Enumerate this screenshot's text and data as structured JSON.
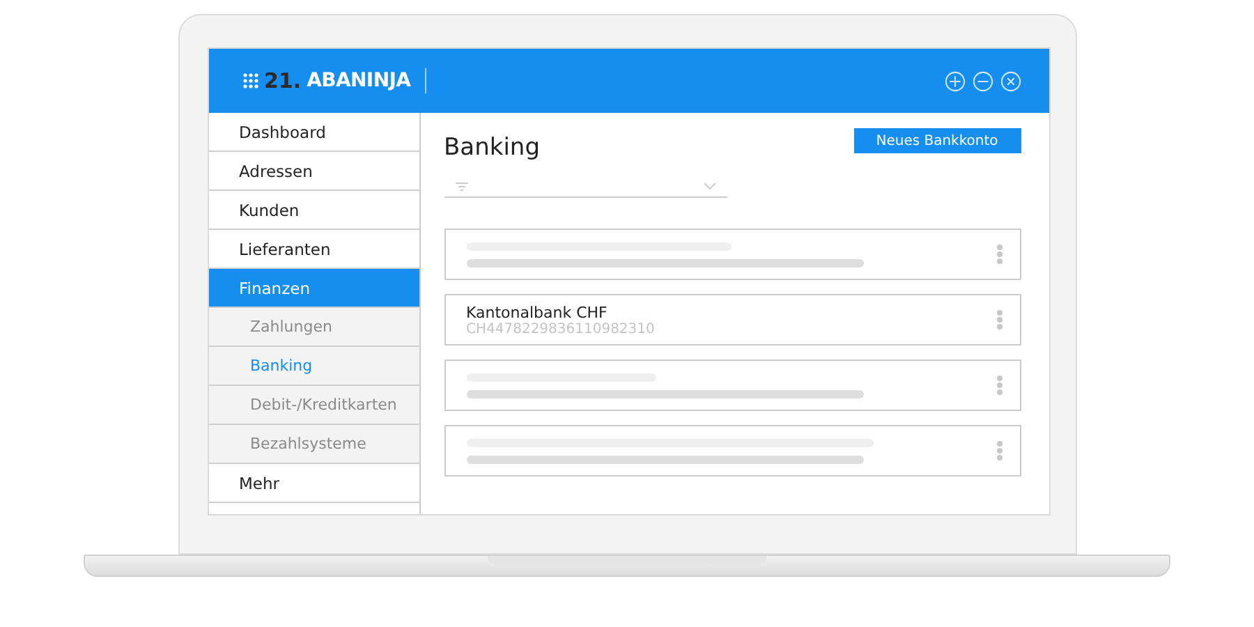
{
  "app": {
    "logo_number": "21.",
    "logo_name": "ABANINJA"
  },
  "sidebar": {
    "items": [
      {
        "label": "Dashboard",
        "kind": "main",
        "selected": false
      },
      {
        "label": "Adressen",
        "kind": "main",
        "selected": false
      },
      {
        "label": "Kunden",
        "kind": "main",
        "selected": false
      },
      {
        "label": "Lieferanten",
        "kind": "main",
        "selected": false
      },
      {
        "label": "Finanzen",
        "kind": "main",
        "selected": true
      },
      {
        "label": "Zahlungen",
        "kind": "sub",
        "selected": false
      },
      {
        "label": "Banking",
        "kind": "sub",
        "selected": true
      },
      {
        "label": "Debit-/Kreditkarten",
        "kind": "sub",
        "selected": false
      },
      {
        "label": "Bezahlsysteme",
        "kind": "sub",
        "selected": false
      },
      {
        "label": "Mehr",
        "kind": "main",
        "selected": false
      }
    ]
  },
  "page": {
    "title": "Banking",
    "new_button": "Neues Bankkonto"
  },
  "accounts": [
    {
      "kind": "placeholder"
    },
    {
      "kind": "account",
      "name": "Kantonalbank CHF",
      "iban": "CH4478229836110982310"
    },
    {
      "kind": "placeholder"
    },
    {
      "kind": "placeholder"
    }
  ]
}
